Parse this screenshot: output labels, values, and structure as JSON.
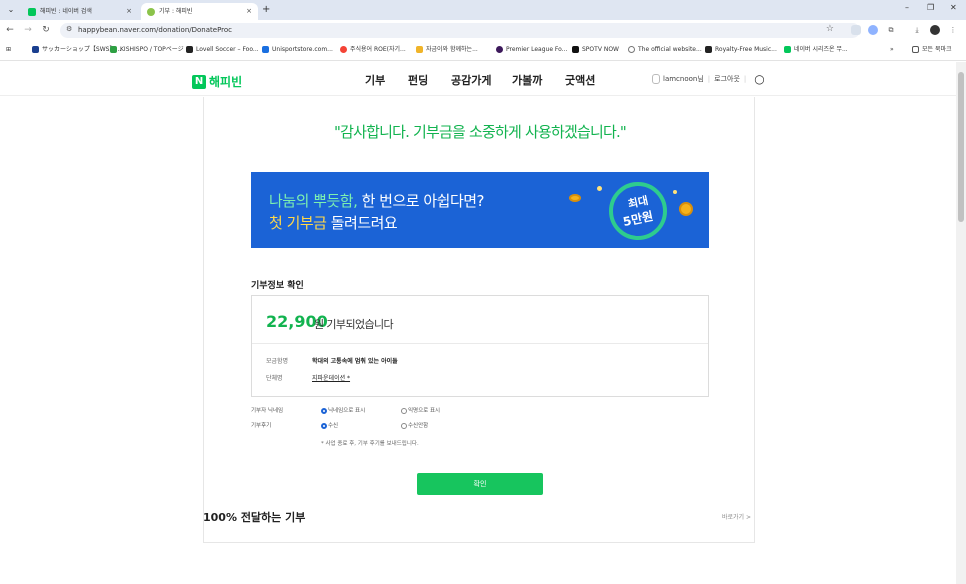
{
  "browser": {
    "tabs": [
      {
        "label": "해피빈 : 네이버 검색",
        "close": "×"
      },
      {
        "label": "기부 : 해피빈",
        "close": "×"
      }
    ],
    "new_tab": "+",
    "window_controls": {
      "minimize": "–",
      "restore": "❐",
      "close": "✕"
    },
    "url": "happybean.naver.com/donation/DonateProc",
    "bookmarks": [
      "サッカーショップ【SWS】...",
      "KISHISPO / TOPページ",
      "Lovell Soccer – Foo...",
      "Unisportstore.com...",
      "주식용어 ROE(자기...",
      "자금이와 함께하는...",
      "Premier League Fo...",
      "SPOTV NOW",
      "The official website...",
      "Royalty-Free Music...",
      "네이버 시리즈온 무..."
    ],
    "bookmarks_more": "»",
    "bookmarks_folder": "모든 북마크"
  },
  "header": {
    "logo_letter": "N",
    "logo_text": "해피빈",
    "nav": [
      "기부",
      "펀딩",
      "공감가게",
      "가볼까",
      "굿액션"
    ],
    "user_name": "lamcnoon님",
    "logout": "로그아웃"
  },
  "main": {
    "thanks_message": "\"감사합니다. 기부금을 소중하게 사용하겠습니다.\"",
    "banner": {
      "line1_highlight": "나눔의 뿌듯함,",
      "line1_rest": " 한 번으로 아쉽다면?",
      "line2_highlight": "첫 기부금",
      "line2_rest": " 돌려드려요",
      "badge_top": "최대",
      "badge_bottom": "5만원"
    },
    "section_title": "기부정보 확인",
    "amount": "22,900",
    "amount_suffix": "원 기부되었습니다",
    "details": [
      {
        "label": "모금함명",
        "value": "학대의 고통속에 멈춰 있는 아이들"
      },
      {
        "label": "단체명",
        "value": "지파운데이션 *"
      }
    ],
    "options": {
      "nickname_label": "기부자 닉네임",
      "nickname_choice1": "닉네임으로 표시",
      "nickname_choice2": "익명으로 표시",
      "review_label": "기부후기",
      "review_choice1": "수신",
      "review_choice2": "수신안함",
      "review_note": "* 사업 종료 후, 기부 후기를 보내드립니다."
    },
    "confirm_label": "확인"
  },
  "footer_section": {
    "title": "100% 전달하는 기부",
    "link": "바로가기 >"
  },
  "colors": {
    "brand_green": "#03c75a",
    "banner_blue": "#1b63d6",
    "confirm_green": "#17c55e"
  }
}
